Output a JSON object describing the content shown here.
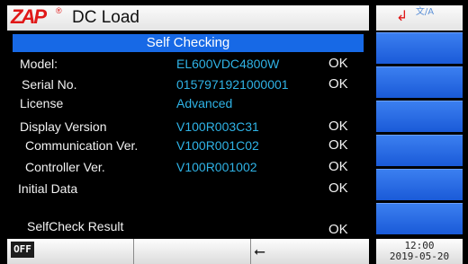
{
  "header": {
    "logo_text": "ZAP",
    "logo_reg": "®",
    "title": "DC Load",
    "corner_icon": "back-arrow-icon",
    "corner_label": "文/A"
  },
  "panel": {
    "title": "Self Checking",
    "rows": [
      {
        "label": "Model:",
        "value": "EL600VDC4800W",
        "status": "OK"
      },
      {
        "label": "Serial No.",
        "value": "0157971921000001",
        "status": "OK"
      },
      {
        "label": "License",
        "value": "Advanced",
        "status": ""
      },
      {
        "label": "Display Version",
        "value": "V100R003C31",
        "status": "OK"
      },
      {
        "label": "Communication Ver.",
        "value": "V100R001C02",
        "status": "OK"
      },
      {
        "label": "Controller Ver.",
        "value": "V100R001002",
        "status": "OK"
      },
      {
        "label": "Initial Data",
        "value": "",
        "status": "OK"
      },
      {
        "label": "SelfCheck Result",
        "value": "",
        "status": "OK"
      }
    ]
  },
  "bottom": {
    "off_label": "OFF",
    "usb_icon": "usb-icon",
    "time": "12:00",
    "date": "2019-05-20"
  },
  "colors": {
    "accent": "#1769e6",
    "value_text": "#2fb3e6",
    "brand_red": "#e01818"
  }
}
